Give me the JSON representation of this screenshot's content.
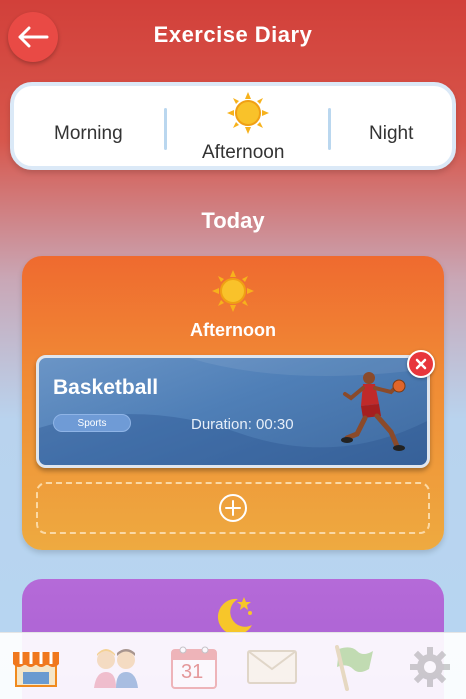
{
  "header": {
    "title": "Exercise Diary"
  },
  "time_of_day": {
    "morning": "Morning",
    "afternoon": "Afternoon",
    "night": "Night",
    "selected": "Afternoon"
  },
  "section": {
    "label": "Today"
  },
  "afternoon_card": {
    "title": "Afternoon",
    "entry": {
      "name": "Basketball",
      "category": "Sports",
      "duration": "Duration: 00:30"
    }
  },
  "tabbar": {
    "items": [
      {
        "icon": "shop-icon",
        "selected": true
      },
      {
        "icon": "friends-icon",
        "selected": false
      },
      {
        "icon": "calendar-icon",
        "label": "31",
        "selected": false
      },
      {
        "icon": "mail-icon",
        "selected": false
      },
      {
        "icon": "flag-icon",
        "selected": false
      },
      {
        "icon": "gear-icon",
        "selected": false
      }
    ]
  },
  "colors": {
    "header_red": "#d2403a",
    "afternoon_orange": "#ef6a2f",
    "night_purple": "#b56ad8",
    "entry_blue": "#4f7fb7",
    "delete_red": "#e8363c"
  }
}
